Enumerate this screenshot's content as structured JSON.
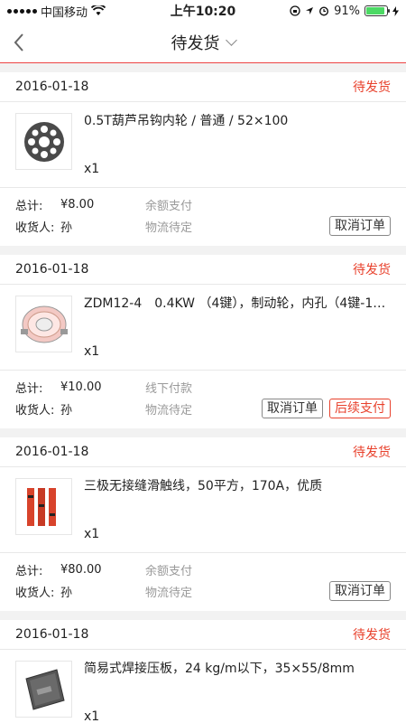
{
  "statusbar": {
    "carrier": "中国移动",
    "time": "上午10:20",
    "battery": "91%"
  },
  "nav": {
    "title": "待发货"
  },
  "orders": [
    {
      "date": "2016-01-18",
      "status": "待发货",
      "product_name": "0.5T葫芦吊钩内轮 / 普通 / 52×100",
      "quantity": "x1",
      "total_label": "总计:",
      "total_value": "¥8.00",
      "payment": "余额支付",
      "receiver_label": "收货人:",
      "receiver": "孙",
      "logistics": "物流待定",
      "btn_cancel": "取消订单"
    },
    {
      "date": "2016-01-18",
      "status": "待发货",
      "product_name": "ZDM12-4　0.4KW （4键），制动轮，内孔（4键-16...",
      "quantity": "x1",
      "total_label": "总计:",
      "total_value": "¥10.00",
      "payment": "线下付款",
      "receiver_label": "收货人:",
      "receiver": "孙",
      "logistics": "物流待定",
      "btn_cancel": "取消订单",
      "btn_pay": "后续支付"
    },
    {
      "date": "2016-01-18",
      "status": "待发货",
      "product_name": "三极无接缝滑触线，50平方，170A，优质",
      "quantity": "x1",
      "total_label": "总计:",
      "total_value": "¥80.00",
      "payment": "余额支付",
      "receiver_label": "收货人:",
      "receiver": "孙",
      "logistics": "物流待定",
      "btn_cancel": "取消订单"
    },
    {
      "date": "2016-01-18",
      "status": "待发货",
      "product_name": "简易式焊接压板，24 kg/m以下，35×55/8mm",
      "quantity": "x1"
    }
  ],
  "colors": {
    "accent": "#e8412c",
    "battery": "#4cd964"
  }
}
